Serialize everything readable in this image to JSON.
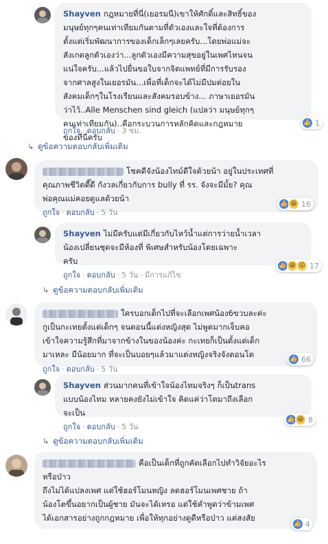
{
  "comments": [
    {
      "author": "Shayven",
      "lines": [
        "กฎหมายที่นี่(เยอรมนี)เขาให้ศักดิ์และสิทธิ์ของ",
        "มนุษย์ทุกๆคนเท่าเทียมกันตามที่ตัวเองและใจที่ต้องการ",
        "ตั้งแต่เริ่มพัฒนาการของเด็กเล็กๆเลยครับ...โดยพ่อแม่จะ",
        "สังเกตลูกตัวเองว่า...ลูกตัวเองมีความสุขอยู่ในเพศไหนจน",
        "แน่ใจครับ...แล้วไปยื่นขอใบจากจิตแพทย์ที่มีการรับรอง",
        "จากศาลสูงในเยอรมัน...เพื่อที่เด็กจะได้ไม่มีปมต่อยใน",
        "สังคมเด็กๆในโรงเรียนและสังคมรอบข้าง... ภาษาเยอรมัน",
        "ว่าไว้..Alle Menschen sind gleich (แปลว่า มนุษย์ทุกๆ",
        "คนเท่าเทียมกัน)..คือกระบวนการหลักคิดและกฎหมาย",
        "ของที่นี่ครับ"
      ],
      "like": "ถูกใจ",
      "reply": "ตอบกลับ",
      "time": "3 ชม.",
      "edited": "",
      "reaction_count": "1"
    },
    {
      "author": "",
      "lines": [
        "โชคดีจังน้องไทม์ดีใจด้วยน้า อยู่ในประเทศที่",
        "คุณภาพชีวิตดี๊ดี กังวลเกี่ยวกับการ bully ที่ รร. จังจะมีมั้ย? คุณ",
        "พ่อคุณแม่คอยดูแลด้วยน้า"
      ],
      "like": "ถูกใจ",
      "reply": "ตอบกลับ",
      "time": "5 วัน",
      "edited": "",
      "reaction_count": "16"
    },
    {
      "author": "Shayven",
      "lines": [
        "ไม่มีครับแต่มีเกี่ยวกับไหว้น้ำแต่การว่ายน้ำเวลา",
        "น้องเปลี่ยนชุดจะมีห้องที่ พิเศษสำหรับน้องโดยเฉพาะ",
        "ครับ"
      ],
      "like": "ถูกใจ",
      "reply": "ตอบกลับ",
      "time": "5 วัน",
      "edited": "มีการแก้ไข",
      "reaction_count": "17"
    },
    {
      "author": "",
      "lines": [
        "ใครบอกเด็กไปที่จะเลือกเพศน้อง6ขวบละค่ะ",
        "กูเป็นกะเทยตั้งแต่เด็กๆ จนตอนนี้แต่งหญิงสุด ไม่พูดมากเจ็บคอ",
        "เข้าใจความรู้สึกที่มาจากข้างในของน้องค่ะ กะเทยก็เป็นตั้งแต่เด็ก",
        "มาเหละ มีน้อยมาก ที่จะเป็นบอยๆแล้วมาแต่งหญิงจริงจังตอนโต"
      ],
      "like": "ถูกใจ",
      "reply": "ตอบกลับ",
      "time": "5 วัน",
      "edited": "",
      "reaction_count": "66"
    },
    {
      "author": "Shayven",
      "lines": [
        "ส่วนมากคนที่เข้าใจน้องไทมจริงๆ ก็เป็นtrans",
        "แบบน้องไทม หลายคงยังไม่เข้าใจ คิดแค่ว่าโตมาถึงเลือก",
        "จะเป็น"
      ],
      "like": "ถูกใจ",
      "reply": "ตอบกลับ",
      "time": "5 วัน",
      "edited": "",
      "reaction_count": "8"
    },
    {
      "author": "",
      "lines": [
        "คือเป็นเด็กที่ถูกคัดเลือกไปทำวิจัยอะไร",
        "หรือป่าว",
        "ถึงไม่ได้แปลงเพศ แต่ใช้ฮอร์โมนหญิง ลดฮอร์โมนเพศชาย ถ้า",
        "น้องโตขึ้นอยากเป็นผู้ชาย มันจะได้เหรอ แต่ใช้คำพูดว่าข้ามเพศ",
        "ได้เอกสารอย่างถูกกฎหมาย เพื่อให้ทุกอย่างดูดีหรือป่าว แค่สงสัย"
      ],
      "like": "",
      "reply": "",
      "time": "",
      "edited": "",
      "reaction_count": "4"
    }
  ],
  "more_replies_label": "ดูข้อความตอบกลับเพิ่มเติม",
  "colors": {
    "link": "#385898",
    "bubble": "#f2f3f5",
    "like": "#4080ff"
  }
}
